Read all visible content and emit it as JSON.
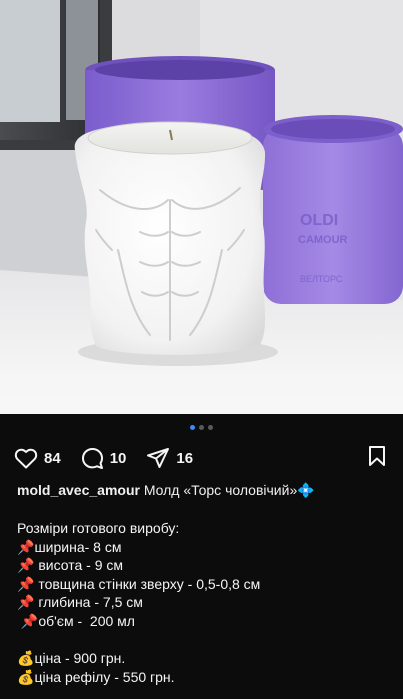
{
  "post": {
    "image_alt_icon": "candle-photo",
    "carousel": {
      "total": 3,
      "active_index": 0
    },
    "actions": {
      "likes": "84",
      "comments": "10",
      "shares": "16"
    },
    "caption": {
      "username": "mold_avec_amour",
      "title": " Молд «Торс чоловічий»",
      "lines": [
        {
          "emoji": "pin",
          "text": "ширина- 8 см",
          "indent": ""
        },
        {
          "emoji": "pin",
          "text": " висота - 9 см",
          "indent": ""
        },
        {
          "emoji": "pin",
          "text": " товщина стінки зверху - 0,5-0,8 см",
          "indent": ""
        },
        {
          "emoji": "pin",
          "text": " глибина - 7,5 см",
          "indent": ""
        },
        {
          "emoji": "pin",
          "text": "об'єм -  200 мл",
          "indent": " "
        }
      ],
      "heading": "Розміри готового виробу:",
      "prices": [
        {
          "emoji": "money-bag",
          "text": "ціна - 900 грн."
        },
        {
          "emoji": "money-bag",
          "text": "ціна рефілу - 550 грн."
        }
      ]
    }
  },
  "colors": {
    "background": "#0c0c0c",
    "text": "#f5f5f5",
    "accent_dot": "#3a8bff",
    "mold_purple": "#8e6cd6"
  }
}
